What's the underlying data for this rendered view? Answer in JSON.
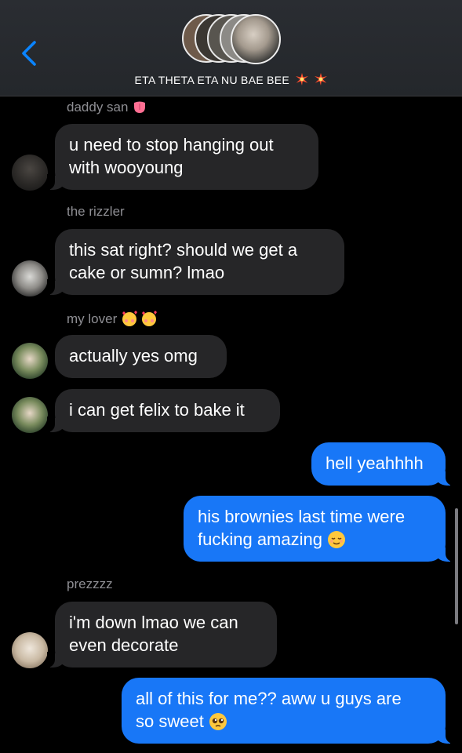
{
  "header": {
    "title": "ETA THETA ETA NU BAE BEE"
  },
  "messages": [
    {
      "sender": "daddy san",
      "text1": "u need to stop hanging out",
      "text2": "with wooyoung"
    },
    {
      "sender": "the rizzler",
      "text1": "this sat right? should we get a",
      "text2": "cake or sumn? lmao"
    },
    {
      "sender": "my lover",
      "text1": "actually yes omg"
    },
    {
      "text1": "i can get felix to bake it"
    },
    {
      "text1": "hell yeahhhh"
    },
    {
      "text1": "his brownies last time were",
      "text2": "fucking amazing"
    },
    {
      "sender": "prezzzz",
      "text1": "i'm down lmao we can",
      "text2": "even decorate"
    },
    {
      "text1": "all of this for me?? aww u guys are",
      "text2": "so sweet"
    }
  ],
  "colors": {
    "outgoing": "#1877f7",
    "incoming": "#262628",
    "accent": "#0a84ff"
  },
  "icons": [
    "back-chevron-icon",
    "sparkle-burst-icon",
    "tongue-emoji-icon",
    "smiling-hearts-emoji-icon",
    "relieved-emoji-icon",
    "pleading-emoji-icon"
  ]
}
